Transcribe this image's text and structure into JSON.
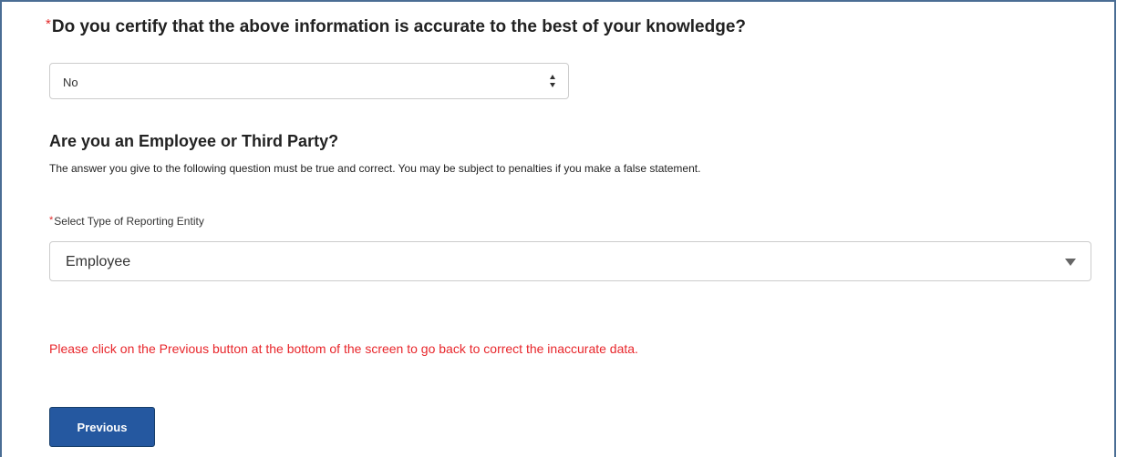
{
  "certify": {
    "required_marker": "*",
    "question": "Do you certify that the above information is accurate to the best of your knowledge?",
    "selected_value": "No"
  },
  "entity": {
    "heading": "Are you an Employee or Third Party?",
    "disclaimer": "The answer you give to the following question must be true and correct. You may be subject to penalties if you make a false statement.",
    "required_marker": "*",
    "select_label": "Select Type of Reporting Entity",
    "selected_value": "Employee"
  },
  "error_message": "Please click on the Previous button at the bottom of the screen to go back to correct the inaccurate data.",
  "colors": {
    "required": "#e22a2a",
    "error": "#e8262b",
    "button_background": "#2558a0",
    "frame_border": "#4a6d94"
  },
  "buttons": {
    "previous_label": "Previous"
  }
}
